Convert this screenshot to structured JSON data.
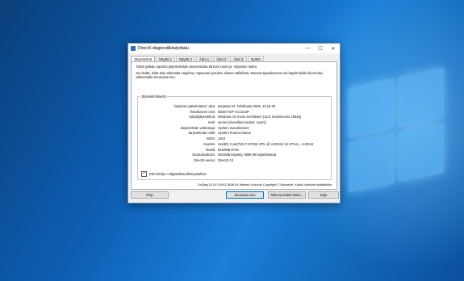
{
  "window": {
    "title": "DirectX-diagnostiikkatyökalu",
    "controls": {
      "minimize": "—",
      "maximize": "☐",
      "close": "✕"
    }
  },
  "tabs": [
    "Järjestelmä",
    "Näyttö 1",
    "Näyttö 2",
    "Ääni 1",
    "Ääni 2",
    "Ääni 3",
    "Syöttö"
  ],
  "intro": {
    "line1": "Tämä työkalu raportoi järjestelmään asennetuista DirectX-osien ja -ohjainten tiedot.",
    "line2": "Jos tiedät, mikä alue aiheuttaa ongelma, napsauta kyseisen alueen välilehteä. Muussa tapauksessa voit käydä kaikki alueet läpi valitsemalla Seuraava-sivu."
  },
  "system_info": {
    "legend": "Järjestelmätiedot",
    "rows": [
      {
        "label": "Nykyinen päivämäärä / aika:",
        "value": "perjantai 24. huhtikuuta 2026, 13.15.39"
      },
      {
        "label": "Tietokoneen nimi:",
        "value": "DESKTOP-AC1S13P"
      },
      {
        "label": "Käyttöjärjestelmä:",
        "value": "Windows 10 Home 64-bittinen (10.0, koontiversio 19045)"
      },
      {
        "label": "Kieli:",
        "value": "suomi (Alueelliset asetus: suomi)"
      },
      {
        "label": "Järjestelmän valmistaja:",
        "value": "System manufacturer"
      },
      {
        "label": "Järjestelmän malli:",
        "value": "System Product Name"
      },
      {
        "label": "BIOS:",
        "value": "1204"
      },
      {
        "label": "Suoritin:",
        "value": "Intel(R) Core(TM) i7-6700K CPU @ 4.00GHz (8 CPUs), ~4.0GHz"
      },
      {
        "label": "Muisti:",
        "value": "8192MB RAM"
      },
      {
        "label": "Sivutustiedosto:",
        "value": "3931MB käytetty, 6098 Mt käytettävissä"
      },
      {
        "label": "DirectX-versio:",
        "value": "DirectX 12"
      }
    ],
    "checkbox_label": "Etsi WHQL:n digitaalisia allekirjoituksia",
    "checkbox_checked": true
  },
  "footer": "DxDiag 10.00.19041.3636 64-bittinen Unicode  Copyright © Microsoft. Kaikki oikeudet pidätetään.",
  "buttons": {
    "help": "Ohje",
    "next": "Seuraava sivu",
    "save": "Tallenna kaikki tiedot...",
    "exit": "Sulje"
  },
  "colors": {
    "accent": "#0078d7",
    "desktop": "#0d5eb3"
  }
}
